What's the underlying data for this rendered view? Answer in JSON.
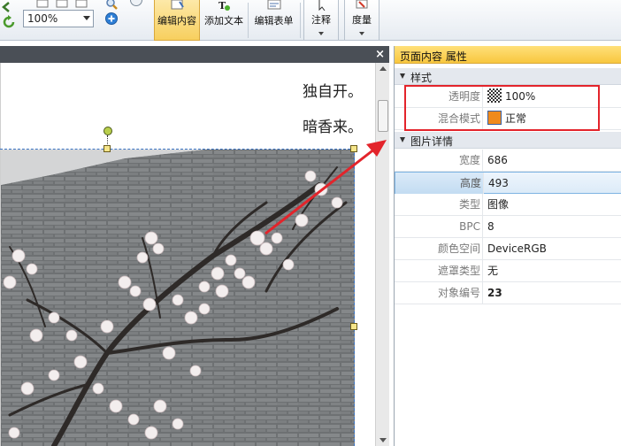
{
  "toolbar": {
    "zoom_value": "100%",
    "edit_content_label": "编辑内容",
    "add_text_label": "添加文本",
    "edit_form_label": "编辑表单",
    "annotate_label": "注释",
    "measure_label": "度量"
  },
  "document": {
    "poem_line_1": "独自开。",
    "poem_line_2": "暗香来。",
    "close_glyph": "×"
  },
  "panel": {
    "title": "页面内容 属性",
    "style_category": "样式",
    "opacity_label": "透明度",
    "opacity_value": "100%",
    "blend_label": "混合模式",
    "blend_value": "正常",
    "details_category": "图片详情",
    "rows": [
      {
        "label": "宽度",
        "value": "686"
      },
      {
        "label": "高度",
        "value": "493"
      },
      {
        "label": "类型",
        "value": "图像"
      },
      {
        "label": "BPC",
        "value": "8"
      },
      {
        "label": "颜色空间",
        "value": "DeviceRGB"
      },
      {
        "label": "遮罩类型",
        "value": "无"
      },
      {
        "label": "对象编号",
        "value": "23"
      }
    ]
  },
  "colors": {
    "highlight_box": "#e3242b",
    "arrow": "#e3242b",
    "selected_row": "#c3dcf2",
    "panel_title": "#f8c73f"
  }
}
